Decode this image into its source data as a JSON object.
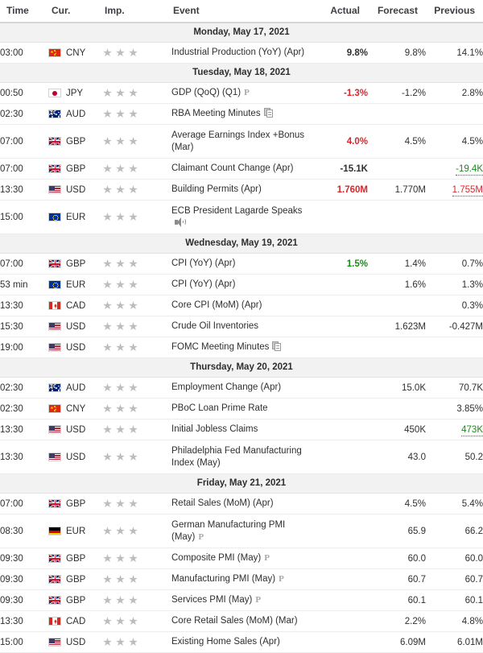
{
  "header": {
    "time": "Time",
    "currency": "Cur.",
    "importance": "Imp.",
    "event": "Event",
    "actual": "Actual",
    "forecast": "Forecast",
    "previous": "Previous"
  },
  "colors": {
    "negative": "#d9262c",
    "positive": "#198c19",
    "neutral": "#2d2f31",
    "star": "#bdbdbd",
    "day_header_bg": "#f2f2f2"
  },
  "rows": [
    {
      "kind": "day",
      "label": "Monday, May 17, 2021"
    },
    {
      "kind": "event",
      "time": "03:00",
      "flag": "cn",
      "currency": "CNY",
      "stars": 3,
      "event": "Industrial Production (YoY) (Apr)",
      "badge": "",
      "actual": "9.8%",
      "actual_tone": "plain",
      "actual_underline": "",
      "forecast": "9.8%",
      "previous": "14.1%",
      "previous_tone": "plain",
      "previous_underline": ""
    },
    {
      "kind": "day",
      "label": "Tuesday, May 18, 2021"
    },
    {
      "kind": "event",
      "time": "00:50",
      "flag": "jp",
      "currency": "JPY",
      "stars": 3,
      "event": "GDP (QoQ) (Q1)",
      "badge": "prelim",
      "actual": "-1.3%",
      "actual_tone": "red",
      "actual_underline": "",
      "forecast": "-1.2%",
      "previous": "2.8%",
      "previous_tone": "plain",
      "previous_underline": ""
    },
    {
      "kind": "event",
      "time": "02:30",
      "flag": "au",
      "currency": "AUD",
      "stars": 3,
      "event": "RBA Meeting Minutes",
      "badge": "doc",
      "actual": "",
      "actual_tone": "plain",
      "actual_underline": "",
      "forecast": "",
      "previous": "",
      "previous_tone": "plain",
      "previous_underline": ""
    },
    {
      "kind": "event",
      "tall": true,
      "time": "07:00",
      "flag": "gb",
      "currency": "GBP",
      "stars": 3,
      "event": "Average Earnings Index +Bonus (Mar)",
      "badge": "",
      "actual": "4.0%",
      "actual_tone": "red",
      "actual_underline": "",
      "forecast": "4.5%",
      "previous": "4.5%",
      "previous_tone": "plain",
      "previous_underline": ""
    },
    {
      "kind": "event",
      "time": "07:00",
      "flag": "gb",
      "currency": "GBP",
      "stars": 3,
      "event": "Claimant Count Change (Apr)",
      "badge": "",
      "actual": "-15.1K",
      "actual_tone": "plain",
      "actual_underline": "",
      "forecast": "",
      "previous": "-19.4K",
      "previous_tone": "green",
      "previous_underline": "green"
    },
    {
      "kind": "event",
      "time": "13:30",
      "flag": "us",
      "currency": "USD",
      "stars": 3,
      "event": "Building Permits (Apr)",
      "badge": "",
      "actual": "1.760M",
      "actual_tone": "red",
      "actual_underline": "",
      "forecast": "1.770M",
      "previous": "1.755M",
      "previous_tone": "red",
      "previous_underline": "red"
    },
    {
      "kind": "event",
      "tall": true,
      "time": "15:00",
      "flag": "eu",
      "currency": "EUR",
      "stars": 3,
      "event": "ECB President Lagarde Speaks",
      "badge": "speaker",
      "badge_newline": true,
      "actual": "",
      "actual_tone": "plain",
      "actual_underline": "",
      "forecast": "",
      "previous": "",
      "previous_tone": "plain",
      "previous_underline": ""
    },
    {
      "kind": "day",
      "label": "Wednesday, May 19, 2021"
    },
    {
      "kind": "event",
      "time": "07:00",
      "flag": "gb",
      "currency": "GBP",
      "stars": 3,
      "event": "CPI (YoY) (Apr)",
      "badge": "",
      "actual": "1.5%",
      "actual_tone": "green",
      "actual_underline": "",
      "forecast": "1.4%",
      "previous": "0.7%",
      "previous_tone": "plain",
      "previous_underline": ""
    },
    {
      "kind": "event",
      "time": "53 min",
      "flag": "eu",
      "currency": "EUR",
      "stars": 3,
      "event": "CPI (YoY) (Apr)",
      "badge": "",
      "actual": "",
      "actual_tone": "plain",
      "actual_underline": "",
      "forecast": "1.6%",
      "previous": "1.3%",
      "previous_tone": "plain",
      "previous_underline": ""
    },
    {
      "kind": "event",
      "time": "13:30",
      "flag": "ca",
      "currency": "CAD",
      "stars": 3,
      "event": "Core CPI (MoM) (Apr)",
      "badge": "",
      "actual": "",
      "actual_tone": "plain",
      "actual_underline": "",
      "forecast": "",
      "previous": "0.3%",
      "previous_tone": "plain",
      "previous_underline": ""
    },
    {
      "kind": "event",
      "time": "15:30",
      "flag": "us",
      "currency": "USD",
      "stars": 3,
      "event": "Crude Oil Inventories",
      "badge": "",
      "actual": "",
      "actual_tone": "plain",
      "actual_underline": "",
      "forecast": "1.623M",
      "previous": "-0.427M",
      "previous_tone": "plain",
      "previous_underline": ""
    },
    {
      "kind": "event",
      "time": "19:00",
      "flag": "us",
      "currency": "USD",
      "stars": 3,
      "event": "FOMC Meeting Minutes",
      "badge": "doc",
      "actual": "",
      "actual_tone": "plain",
      "actual_underline": "",
      "forecast": "",
      "previous": "",
      "previous_tone": "plain",
      "previous_underline": ""
    },
    {
      "kind": "day",
      "label": "Thursday, May 20, 2021"
    },
    {
      "kind": "event",
      "time": "02:30",
      "flag": "au",
      "currency": "AUD",
      "stars": 3,
      "event": "Employment Change (Apr)",
      "badge": "",
      "actual": "",
      "actual_tone": "plain",
      "actual_underline": "",
      "forecast": "15.0K",
      "previous": "70.7K",
      "previous_tone": "plain",
      "previous_underline": ""
    },
    {
      "kind": "event",
      "time": "02:30",
      "flag": "cn",
      "currency": "CNY",
      "stars": 3,
      "event": "PBoC Loan Prime Rate",
      "badge": "",
      "actual": "",
      "actual_tone": "plain",
      "actual_underline": "",
      "forecast": "",
      "previous": "3.85%",
      "previous_tone": "plain",
      "previous_underline": ""
    },
    {
      "kind": "event",
      "time": "13:30",
      "flag": "us",
      "currency": "USD",
      "stars": 3,
      "event": "Initial Jobless Claims",
      "badge": "",
      "actual": "",
      "actual_tone": "plain",
      "actual_underline": "",
      "forecast": "450K",
      "previous": "473K",
      "previous_tone": "green",
      "previous_underline": "green"
    },
    {
      "kind": "event",
      "tall": true,
      "time": "13:30",
      "flag": "us",
      "currency": "USD",
      "stars": 3,
      "event": "Philadelphia Fed Manufacturing Index (May)",
      "badge": "",
      "actual": "",
      "actual_tone": "plain",
      "actual_underline": "",
      "forecast": "43.0",
      "previous": "50.2",
      "previous_tone": "plain",
      "previous_underline": ""
    },
    {
      "kind": "day",
      "label": "Friday, May 21, 2021"
    },
    {
      "kind": "event",
      "time": "07:00",
      "flag": "gb",
      "currency": "GBP",
      "stars": 3,
      "event": "Retail Sales (MoM) (Apr)",
      "badge": "",
      "actual": "",
      "actual_tone": "plain",
      "actual_underline": "",
      "forecast": "4.5%",
      "previous": "5.4%",
      "previous_tone": "plain",
      "previous_underline": ""
    },
    {
      "kind": "event",
      "tall": true,
      "time": "08:30",
      "flag": "de",
      "currency": "EUR",
      "stars": 3,
      "event": "German Manufacturing PMI (May)",
      "badge": "prelim",
      "actual": "",
      "actual_tone": "plain",
      "actual_underline": "",
      "forecast": "65.9",
      "previous": "66.2",
      "previous_tone": "plain",
      "previous_underline": ""
    },
    {
      "kind": "event",
      "time": "09:30",
      "flag": "gb",
      "currency": "GBP",
      "stars": 3,
      "event": "Composite PMI (May)",
      "badge": "prelim",
      "actual": "",
      "actual_tone": "plain",
      "actual_underline": "",
      "forecast": "60.0",
      "previous": "60.0",
      "previous_tone": "plain",
      "previous_underline": ""
    },
    {
      "kind": "event",
      "time": "09:30",
      "flag": "gb",
      "currency": "GBP",
      "stars": 3,
      "event": "Manufacturing PMI (May)",
      "badge": "prelim",
      "actual": "",
      "actual_tone": "plain",
      "actual_underline": "",
      "forecast": "60.7",
      "previous": "60.7",
      "previous_tone": "plain",
      "previous_underline": ""
    },
    {
      "kind": "event",
      "time": "09:30",
      "flag": "gb",
      "currency": "GBP",
      "stars": 3,
      "event": "Services PMI (May)",
      "badge": "prelim",
      "actual": "",
      "actual_tone": "plain",
      "actual_underline": "",
      "forecast": "60.1",
      "previous": "60.1",
      "previous_tone": "plain",
      "previous_underline": ""
    },
    {
      "kind": "event",
      "time": "13:30",
      "flag": "ca",
      "currency": "CAD",
      "stars": 3,
      "event": "Core Retail Sales (MoM) (Mar)",
      "badge": "",
      "actual": "",
      "actual_tone": "plain",
      "actual_underline": "",
      "forecast": "2.2%",
      "previous": "4.8%",
      "previous_tone": "plain",
      "previous_underline": ""
    },
    {
      "kind": "event",
      "time": "15:00",
      "flag": "us",
      "currency": "USD",
      "stars": 3,
      "event": "Existing Home Sales (Apr)",
      "badge": "",
      "actual": "",
      "actual_tone": "plain",
      "actual_underline": "",
      "forecast": "6.09M",
      "previous": "6.01M",
      "previous_tone": "plain",
      "previous_underline": ""
    }
  ]
}
